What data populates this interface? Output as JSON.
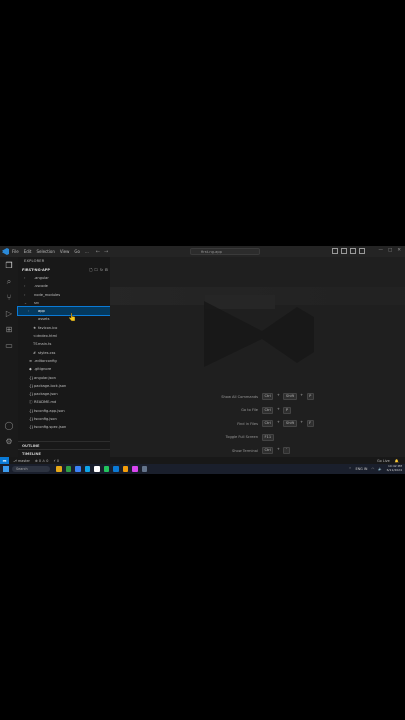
{
  "titlebar": {
    "menu": [
      "File",
      "Edit",
      "Selection",
      "View",
      "Go",
      "..."
    ],
    "search_placeholder": "first-ng-app",
    "window_buttons": [
      "—",
      "□",
      "✕"
    ]
  },
  "sidebar": {
    "header": "EXPLORER",
    "project": "FIRST-NG-APP",
    "tree": [
      {
        "label": ".angular",
        "indent": 1,
        "chevron": "›",
        "icon": "",
        "color": "#c0c0c0"
      },
      {
        "label": ".vscode",
        "indent": 1,
        "chevron": "›",
        "icon": "",
        "color": "#c0c0c0"
      },
      {
        "label": "node_modules",
        "indent": 1,
        "chevron": "›",
        "icon": "",
        "color": "#c0c0c0"
      },
      {
        "label": "src",
        "indent": 1,
        "chevron": "⌄",
        "icon": "",
        "color": "#c0c0c0"
      },
      {
        "label": "app",
        "indent": 2,
        "chevron": "›",
        "icon": "",
        "color": "#ffffff",
        "selected": true
      },
      {
        "label": "assets",
        "indent": 2,
        "chevron": "",
        "icon": "",
        "color": "#c0c0c0"
      },
      {
        "label": "favicon.ico",
        "indent": 2,
        "chevron": "",
        "icon": "★",
        "color": "#c0c0c0"
      },
      {
        "label": "index.html",
        "indent": 2,
        "chevron": "",
        "icon": "<>",
        "color": "#c0c0c0"
      },
      {
        "label": "main.ts",
        "indent": 2,
        "chevron": "",
        "icon": "TS",
        "color": "#c0c0c0"
      },
      {
        "label": "styles.css",
        "indent": 2,
        "chevron": "",
        "icon": "#",
        "color": "#c0c0c0"
      },
      {
        "label": ".editorconfig",
        "indent": 1,
        "chevron": "",
        "icon": "≡",
        "color": "#c0c0c0"
      },
      {
        "label": ".gitignore",
        "indent": 1,
        "chevron": "",
        "icon": "◆",
        "color": "#c0c0c0"
      },
      {
        "label": "angular.json",
        "indent": 1,
        "chevron": "",
        "icon": "{}",
        "color": "#c0c0c0"
      },
      {
        "label": "package-lock.json",
        "indent": 1,
        "chevron": "",
        "icon": "{}",
        "color": "#c0c0c0"
      },
      {
        "label": "package.json",
        "indent": 1,
        "chevron": "",
        "icon": "{}",
        "color": "#c0c0c0"
      },
      {
        "label": "README.md",
        "indent": 1,
        "chevron": "",
        "icon": "ⓘ",
        "color": "#c0c0c0"
      },
      {
        "label": "tsconfig.app.json",
        "indent": 1,
        "chevron": "",
        "icon": "{}",
        "color": "#c0c0c0"
      },
      {
        "label": "tsconfig.json",
        "indent": 1,
        "chevron": "",
        "icon": "{}",
        "color": "#c0c0c0"
      },
      {
        "label": "tsconfig.spec.json",
        "indent": 1,
        "chevron": "",
        "icon": "{}",
        "color": "#c0c0c0"
      }
    ],
    "outline_label": "OUTLINE",
    "timeline_label": "TIMELINE"
  },
  "editor": {
    "shortcuts": [
      {
        "label": "Show All Commands",
        "keys": [
          "Ctrl",
          "+",
          "Shift",
          "+",
          "P"
        ]
      },
      {
        "label": "Go to File",
        "keys": [
          "Ctrl",
          "+",
          "P"
        ]
      },
      {
        "label": "Find in Files",
        "keys": [
          "Ctrl",
          "+",
          "Shift",
          "+",
          "F"
        ]
      },
      {
        "label": "Toggle Full Screen",
        "keys": [
          "F11"
        ]
      },
      {
        "label": "Show Terminal",
        "keys": [
          "Ctrl",
          "+",
          "`"
        ]
      }
    ]
  },
  "statusbar": {
    "remote_icon": "⫘",
    "items": [
      "⎇ master",
      "⊗ 0 ⚠ 0",
      "⚡ 0"
    ],
    "right": [
      "Go Live",
      "🔔"
    ]
  },
  "taskbar": {
    "search_placeholder": "Search",
    "app_colors": [
      "#e6a817",
      "#2f9e44",
      "#3b82f6",
      "#0ea5e9",
      "#ffffff",
      "#22c55e",
      "#0a7ad6",
      "#f59e0b",
      "#d946ef",
      "#64748b"
    ],
    "time": "10:42 PM",
    "date": "6/11/2024",
    "lang": "ENG IN"
  },
  "colors": {
    "accent": "#0a7ad6",
    "selection": "#04395e",
    "editor_bg": "#1f1f1f",
    "sidebar_bg": "#181818"
  }
}
